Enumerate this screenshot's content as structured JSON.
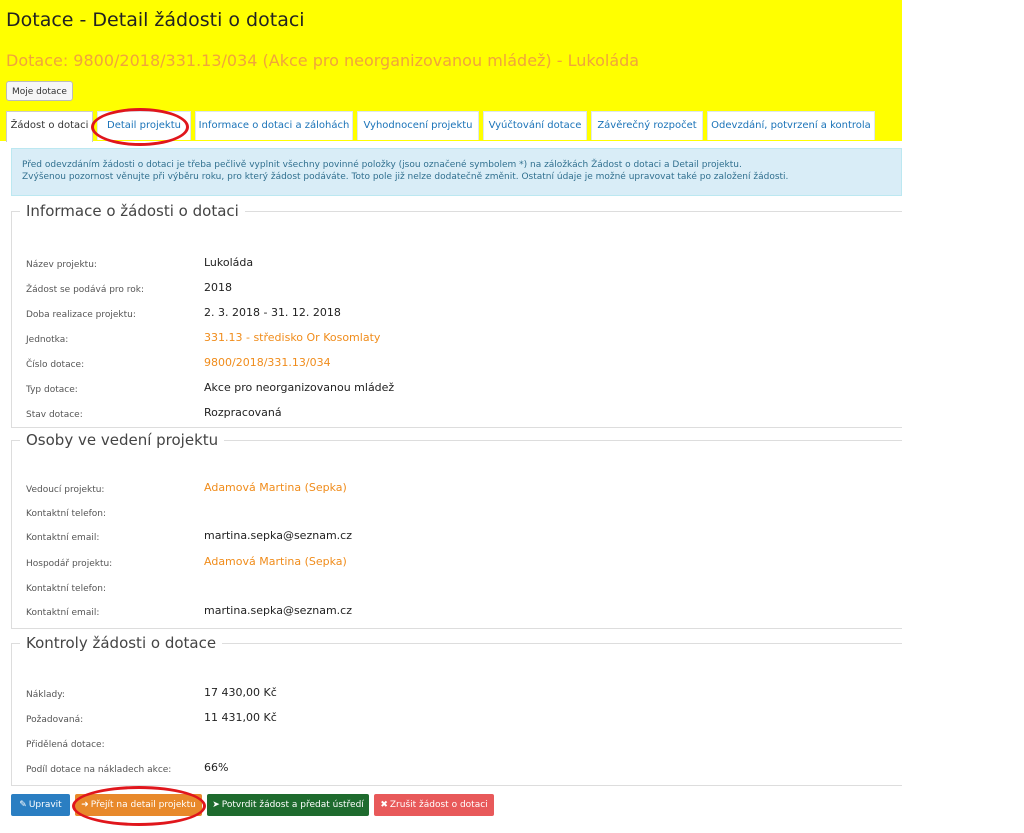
{
  "header": {
    "title": "Dotace - Detail žádosti o dotaci",
    "subtitle": "Dotace: 9800/2018/331.13/034 (Akce pro neorganizovanou mládež) - Lukoláda",
    "my_grants_button": "Moje dotace"
  },
  "tabs": [
    {
      "label": "Žádost o dotaci",
      "active": true
    },
    {
      "label": "Detail projektu",
      "active": false
    },
    {
      "label": "Informace o dotaci a zálohách",
      "active": false
    },
    {
      "label": "Vyhodnocení projektu",
      "active": false
    },
    {
      "label": "Vyúčtování dotace",
      "active": false
    },
    {
      "label": "Závěrečný rozpočet",
      "active": false
    },
    {
      "label": "Odevzdání, potvrzení a kontrola",
      "active": false
    }
  ],
  "alert": {
    "line1": "Před odevzdáním žádosti o dotaci je třeba pečlivě vyplnit všechny povinné položky (jsou označené symbolem *) na záložkách Žádost o dotaci a Detail projektu.",
    "line2": "Zvýšenou pozornost věnujte při výběru roku, pro který žádost podáváte. Toto pole již nelze dodatečně změnit. Ostatní údaje je možné upravovat také po založení žádosti."
  },
  "info_section": {
    "legend": "Informace o žádosti o dotaci",
    "rows": [
      {
        "label": "Název projektu:",
        "value": "Lukoláda"
      },
      {
        "label": "Žádost se podává pro rok:",
        "value": "2018"
      },
      {
        "label": "Doba realizace projektu:",
        "value": "2. 3. 2018 - 31. 12. 2018"
      },
      {
        "label": "Jednotka:",
        "value": "331.13 - středisko Or Kosomlaty"
      },
      {
        "label": "Číslo dotace:",
        "value": "9800/2018/331.13/034"
      },
      {
        "label": "Typ dotace:",
        "value": "Akce pro neorganizovanou mládež"
      },
      {
        "label": "Stav dotace:",
        "value": "Rozpracovaná"
      }
    ]
  },
  "persons_section": {
    "legend": "Osoby ve vedení projektu",
    "rows": [
      {
        "label": "Vedoucí projektu:",
        "value": "Adamová Martina (Sepka)"
      },
      {
        "label": "Kontaktní telefon:",
        "value": ""
      },
      {
        "label": "Kontaktní email:",
        "value": "martina.sepka@seznam.cz"
      },
      {
        "label": "Hospodář projektu:",
        "value": "Adamová Martina (Sepka)"
      },
      {
        "label": "Kontaktní telefon:",
        "value": ""
      },
      {
        "label": "Kontaktní email:",
        "value": "martina.sepka@seznam.cz"
      }
    ]
  },
  "checks_section": {
    "legend": "Kontroly žádosti o dotace",
    "rows": [
      {
        "label": "Náklady:",
        "value": "17 430,00 Kč"
      },
      {
        "label": "Požadovaná:",
        "value": "11 431,00 Kč"
      },
      {
        "label": "Přidělená dotace:",
        "value": ""
      },
      {
        "label": "Podíl dotace na nákladech akce:",
        "value": "66%"
      }
    ]
  },
  "actions": {
    "edit": "Upravit",
    "go_to_detail": "Přejít na detail projektu",
    "confirm": "Potvrdit žádost a předat ústředí",
    "cancel": "Zrušit žádost o dotaci"
  },
  "colors": {
    "header_bg": "#ffff00",
    "subtitle": "#f0a43b",
    "link_orange": "#f08c1b",
    "tab_link": "#1a73b8",
    "alert_bg": "#d9edf7",
    "alert_text": "#31708f",
    "btn_edit": "#2a7ec2",
    "btn_detail": "#e8892b",
    "btn_confirm": "#1e6b2e",
    "btn_cancel": "#e8595a",
    "annotation_circle": "#e0161c"
  }
}
